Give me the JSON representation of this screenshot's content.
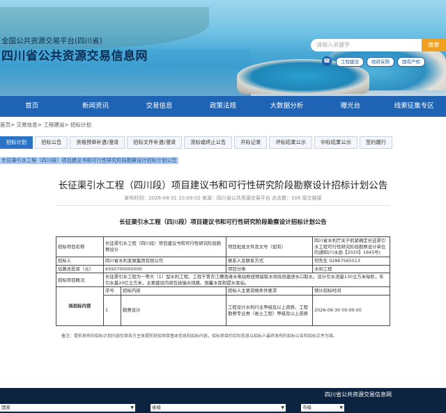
{
  "header": {
    "platform_sub": "全国公共资源交易平台(四川省)",
    "platform_main": "四川省公共资源交易信息网",
    "search_placeholder": "请输入关键字",
    "search_button": "搜索",
    "quick_links": [
      "工程建设",
      "政府采购",
      "国有产权"
    ]
  },
  "nav": [
    "首页",
    "新闻资讯",
    "交易信息",
    "政策法规",
    "大数据分析",
    "曝光台",
    "线索征集专区"
  ],
  "breadcrumb": "首页> 交易信息> 工程建设> 招标计划",
  "tabs": [
    "招标计划",
    "招标公告",
    "资格预审补遗/澄清",
    "招标文件补遗/澄清",
    "流标或终止公告",
    "开标记录",
    "评标结果公示",
    "中标结果公示",
    "签约履行"
  ],
  "selected_line": "长征渠引水工程（四川段）项目建议书和可行性研究阶段勘察设计招标计划公告",
  "article": {
    "title": "长征渠引水工程（四川段）项目建议书和可行性研究阶段勘察设计招标计划公告",
    "meta": "发布时间：2026-08-31 10:09:02    来源：四川省公共资源交易平台    点击数：106    原文链接",
    "doc_title": "长征渠引水工程（四川段）项目建议书和可行性研究阶段勘察设计招标计划公告"
  },
  "table": {
    "r1": [
      "招标项目名称",
      "长征渠引水工程（四川段）项目建议书和可行性研究阶段勘察设计",
      "项目批准文件及文号（如有）",
      "四川省水利厅关于抓紧确定长征渠引水工程可行性研究阶段勘察设计单位的通知(川水函【2020】1645号)"
    ],
    "r2": [
      "招标人",
      "四川省水利发展集团有限公司",
      "联系人及联系方式",
      "何先生 02867565513"
    ],
    "r3": [
      "估算总投资（元）",
      "6595700000000",
      "项目分类",
      "水利工程"
    ],
    "r4": [
      "招标项目概况",
      "长征渠引水工程为一等大（1）型水利工程，工程于青衣江槽渔滩水电站枢纽预留取水坝段改建进水口取水，设计引水流量130立方米每秒，年引水量20亿立方米，主要建设内容包括输水线路、囤蓄水库和提水泵站。"
    ],
    "r5_label": "拟招标内容",
    "sub_head": [
      "序号",
      "招标内容",
      "招标人主要资格条件要求",
      "预计招标时间"
    ],
    "sub_row": [
      "1",
      "勘察设计",
      "工程设计水利行业甲级及以上资质、工程勘察专业类（岩土工程）甲级及以上资质",
      "2026-09-30 00:00:00"
    ]
  },
  "note": "备注：提前发布的招标计划内容仅供各方主体提前获知项目基本信息和招标内容，招标项目的实际信息以招标人最终发布的招标公告和招标文件为准。",
  "footer": {
    "selects": [
      "国家",
      "省级",
      "市级"
    ],
    "watermark": "四川省公共资源交易信息网"
  }
}
